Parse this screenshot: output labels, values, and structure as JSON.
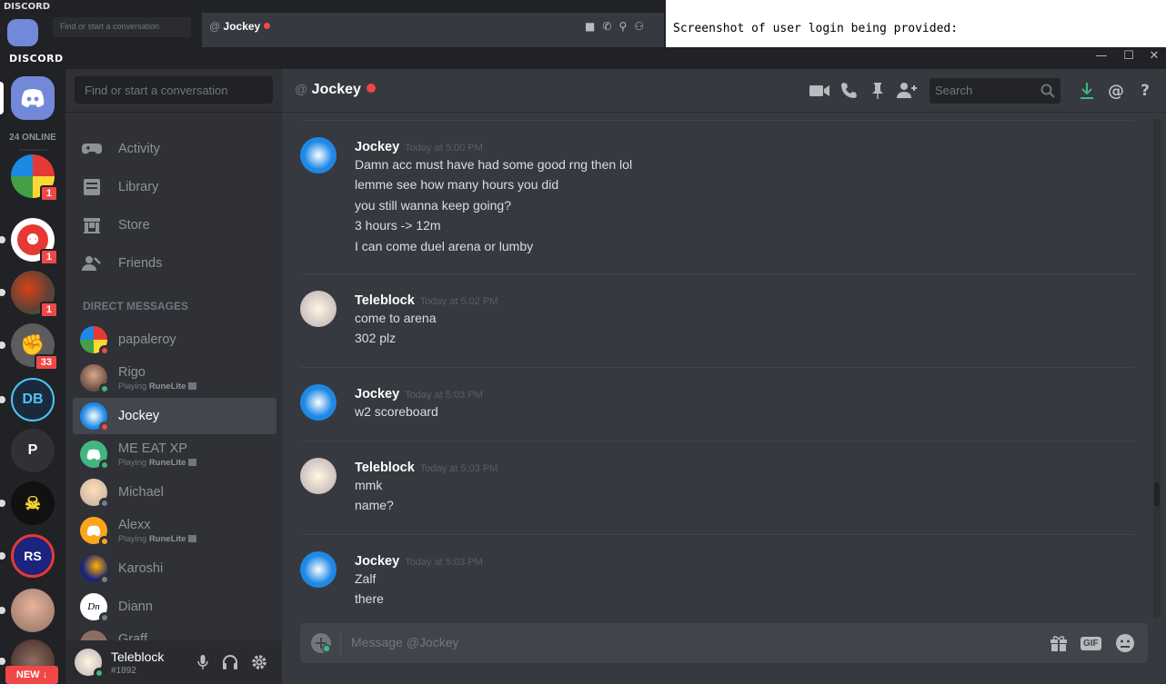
{
  "background_window": {
    "logo": "DISCORD",
    "search_placeholder": "Find or start a conversation",
    "channel": "Jockey",
    "side_text": "Screenshot of user login being provided:"
  },
  "window": {
    "logo": "DISCORD",
    "controls": [
      "—",
      "☐",
      "✕"
    ]
  },
  "guilds": {
    "online_label": "24 ONLINE",
    "items": [
      {
        "name": "rubiks-cube-server",
        "badge": "1"
      },
      {
        "name": "red-face-server",
        "badge": "1"
      },
      {
        "name": "pirate-server",
        "badge": "1"
      },
      {
        "name": "grey-server",
        "badge": "33"
      },
      {
        "name": "db-server",
        "badge": ""
      },
      {
        "name": "p-server",
        "letter": "P",
        "badge": ""
      },
      {
        "name": "skull-server",
        "badge": ""
      },
      {
        "name": "rs-server",
        "badge": ""
      },
      {
        "name": "bald-server",
        "badge": ""
      },
      {
        "name": "mug-server",
        "badge": ""
      }
    ],
    "new_label": "NEW ↓"
  },
  "sidebar": {
    "search_placeholder": "Find or start a conversation",
    "nav": [
      {
        "label": "Activity",
        "icon": "gamepad-icon"
      },
      {
        "label": "Library",
        "icon": "library-icon"
      },
      {
        "label": "Store",
        "icon": "store-icon"
      },
      {
        "label": "Friends",
        "icon": "friends-icon"
      }
    ],
    "dm_header": "DIRECT MESSAGES",
    "dms": [
      {
        "name": "papaleroy",
        "status": "dnd",
        "sub": ""
      },
      {
        "name": "Rigo",
        "status": "online",
        "sub_prefix": "Playing ",
        "sub_game": "RuneLite"
      },
      {
        "name": "Jockey",
        "status": "dnd",
        "sub": "",
        "selected": true
      },
      {
        "name": "ME EAT XP",
        "status": "online",
        "sub_prefix": "Playing ",
        "sub_game": "RuneLite"
      },
      {
        "name": "Michael",
        "status": "offline",
        "sub": ""
      },
      {
        "name": "Alexx",
        "status": "idle",
        "sub_prefix": "Playing ",
        "sub_game": "RuneLite"
      },
      {
        "name": "Karoshi",
        "status": "offline",
        "sub": ""
      },
      {
        "name": "Diann",
        "status": "offline",
        "sub": ""
      },
      {
        "name": "Graff",
        "status": "offline",
        "sub": ""
      }
    ],
    "user": {
      "name": "Teleblock",
      "tag": "#1892"
    }
  },
  "chat": {
    "at": "@",
    "channel": "Jockey",
    "search_placeholder": "Search",
    "composer_placeholder": "Message @Jockey",
    "messages": [
      {
        "author": "Jockey",
        "time": "Today at 5:00 PM",
        "lines": [
          "Damn acc must have had some good rng then lol",
          "lemme see how many hours you did",
          "you still wanna keep going?",
          "3 hours -> 12m",
          "I can come duel arena or lumby"
        ]
      },
      {
        "author": "Teleblock",
        "time": "Today at 5:02 PM",
        "lines": [
          "come to arena",
          "302 plz"
        ]
      },
      {
        "author": "Jockey",
        "time": "Today at 5:03 PM",
        "lines": [
          "w2 scoreboard"
        ]
      },
      {
        "author": "Teleblock",
        "time": "Today at 5:03 PM",
        "lines": [
          "mmk",
          "name?"
        ]
      },
      {
        "author": "Jockey",
        "time": "Today at 5:03 PM",
        "lines": [
          "Zalf",
          "there"
        ]
      }
    ]
  },
  "colors": {
    "accent": "#7289da",
    "online": "#43b581",
    "idle": "#faa61a",
    "dnd": "#f04747",
    "offline": "#747f8d"
  }
}
